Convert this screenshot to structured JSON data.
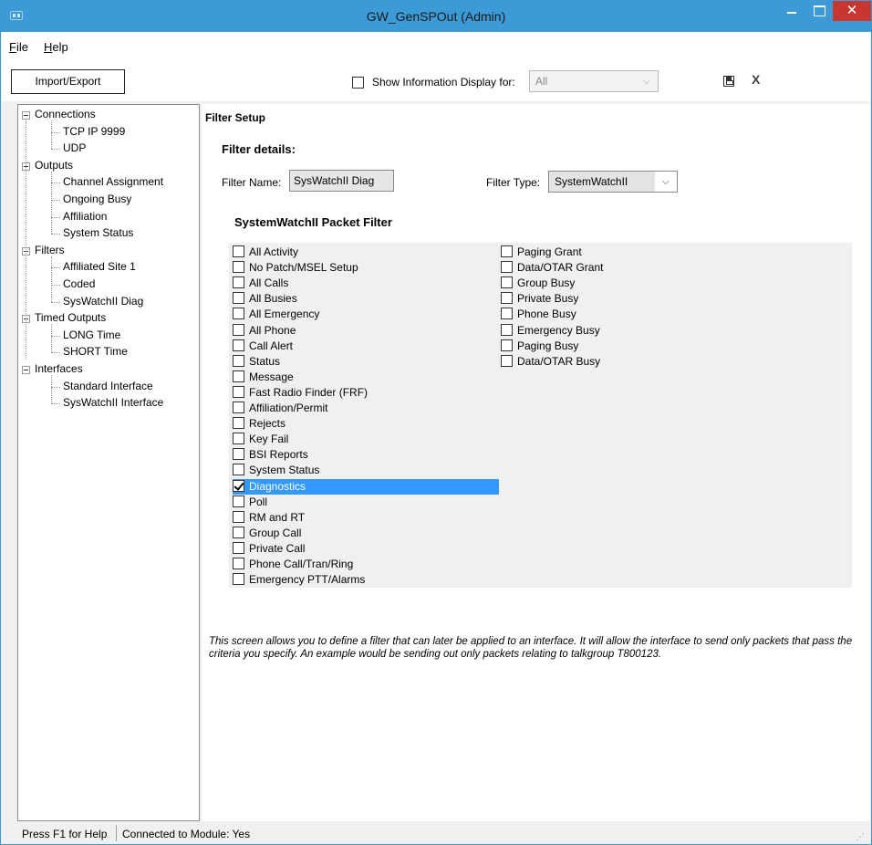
{
  "window": {
    "title": "GW_GenSPOut (Admin)"
  },
  "menu": [
    {
      "label": "File",
      "mnemonic": "F",
      "rest": "ile"
    },
    {
      "label": "Help",
      "mnemonic": "H",
      "rest": "elp"
    }
  ],
  "toolbar": {
    "import_export_label": "Import/Export",
    "show_info_label": "Show Information Display for:",
    "show_info_checked": false,
    "show_info_select_value": "All",
    "close_label": "X"
  },
  "tree": {
    "groups": [
      {
        "label": "Connections",
        "children": [
          "TCP IP 9999",
          "UDP"
        ]
      },
      {
        "label": "Outputs",
        "children": [
          "Channel Assignment",
          "Ongoing Busy",
          "Affiliation",
          "System Status"
        ]
      },
      {
        "label": "Filters",
        "children": [
          "Affiliated Site 1",
          "Coded",
          "SysWatchII Diag"
        ]
      },
      {
        "label": "Timed Outputs",
        "children": [
          "LONG Time",
          "SHORT Time"
        ]
      },
      {
        "label": "Interfaces",
        "children": [
          "Standard Interface",
          "SysWatchII Interface"
        ]
      }
    ]
  },
  "filter": {
    "section_title": "Filter Setup",
    "details_title": "Filter details:",
    "name_label": "Filter Name:",
    "name_value": "SysWatchII Diag",
    "type_label": "Filter Type:",
    "type_value": "SystemWatchII",
    "packet_title": "SystemWatchII Packet Filter",
    "options_col1": [
      {
        "label": "All Activity",
        "checked": false
      },
      {
        "label": "No Patch/MSEL Setup",
        "checked": false
      },
      {
        "label": "All Calls",
        "checked": false
      },
      {
        "label": "All Busies",
        "checked": false
      },
      {
        "label": "All Emergency",
        "checked": false
      },
      {
        "label": "All Phone",
        "checked": false
      },
      {
        "label": "Call Alert",
        "checked": false
      },
      {
        "label": "Status",
        "checked": false
      },
      {
        "label": "Message",
        "checked": false
      },
      {
        "label": "Fast Radio Finder (FRF)",
        "checked": false
      },
      {
        "label": "Affiliation/Permit",
        "checked": false
      },
      {
        "label": "Rejects",
        "checked": false
      },
      {
        "label": "Key Fail",
        "checked": false
      },
      {
        "label": "BSI Reports",
        "checked": false
      },
      {
        "label": "System Status",
        "checked": false
      },
      {
        "label": "Diagnostics",
        "checked": true,
        "selected": true
      },
      {
        "label": "Poll",
        "checked": false
      },
      {
        "label": "RM and RT",
        "checked": false
      },
      {
        "label": "Group Call",
        "checked": false
      },
      {
        "label": "Private Call",
        "checked": false
      },
      {
        "label": "Phone Call/Tran/Ring",
        "checked": false
      },
      {
        "label": "Emergency PTT/Alarms",
        "checked": false
      }
    ],
    "options_col2": [
      {
        "label": "Paging Grant",
        "checked": false
      },
      {
        "label": "Data/OTAR Grant",
        "checked": false
      },
      {
        "label": "Group Busy",
        "checked": false
      },
      {
        "label": "Private Busy",
        "checked": false
      },
      {
        "label": "Phone Busy",
        "checked": false
      },
      {
        "label": "Emergency Busy",
        "checked": false
      },
      {
        "label": "Paging Busy",
        "checked": false
      },
      {
        "label": "Data/OTAR Busy",
        "checked": false
      }
    ],
    "help_text": "This screen allows you to define a filter that can later be applied to an interface.  It will allow the interface to send only packets that pass the criteria you specify.  An example would be sending out only packets relating to talkgroup T800123."
  },
  "status": {
    "help_hint": "Press F1 for Help",
    "connection": "Connected to Module: Yes"
  }
}
